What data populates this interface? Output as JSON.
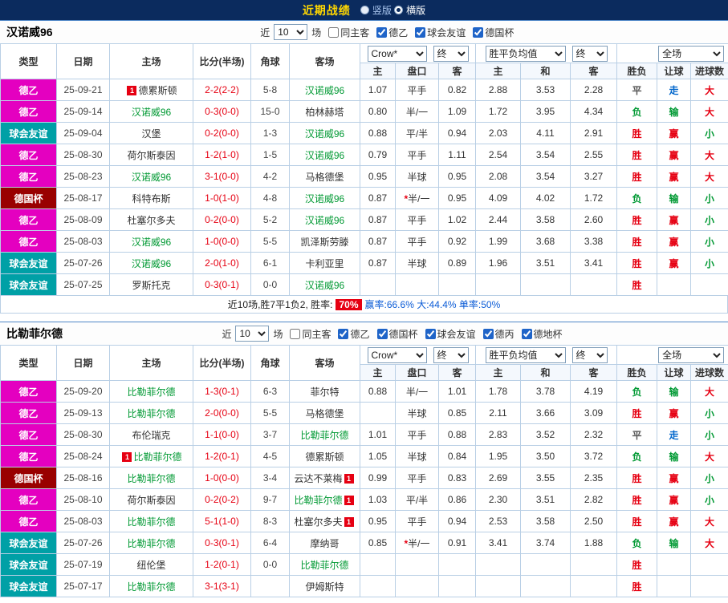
{
  "top_bar": {
    "title": "近期战绩",
    "layout_options": [
      {
        "label": "竖版",
        "selected": false
      },
      {
        "label": "横版",
        "selected": true
      }
    ]
  },
  "colors": {
    "topbar_bg": "#0b2b5e",
    "title": "#ffd700",
    "red": "#e60012",
    "green": "#009933",
    "blue": "#0066cc",
    "dark": "#555",
    "focal_team": "#009933",
    "types": {
      "德乙": "#e400c0",
      "球会友谊": "#00a0a6",
      "德国杯": "#990000"
    }
  },
  "table_header": {
    "type": "类型",
    "date": "日期",
    "home": "主场",
    "score": "比分(半场)",
    "corners": "角球",
    "away": "客场",
    "odds_source": "Crow*",
    "final": "终",
    "avg_label": "胜平负均值",
    "scope": "全场",
    "ah_home": "主",
    "ah_line": "盘口",
    "ah_away": "客",
    "eu_home": "主",
    "eu_draw": "和",
    "eu_away": "客",
    "result": "胜负",
    "handicap": "让球",
    "goals": "进球数"
  },
  "sections": [
    {
      "team": "汉诺威96",
      "controls": {
        "near": "近",
        "count": "10",
        "unit": "场",
        "same_venue": {
          "label": "同主客",
          "checked": false
        },
        "filters": [
          {
            "label": "德乙",
            "checked": true
          },
          {
            "label": "球会友谊",
            "checked": true
          },
          {
            "label": "德国杯",
            "checked": true
          }
        ]
      },
      "rows": [
        {
          "type": "德乙",
          "date": "25-09-21",
          "home": {
            "name": "德累斯顿",
            "badge": "1"
          },
          "score": "2-2(2-2)",
          "corners": "5-8",
          "away": {
            "name": "汉诺威96",
            "focal": true
          },
          "ah": [
            "1.07",
            "平手",
            "0.82"
          ],
          "eu": [
            "2.88",
            "3.53",
            "2.28"
          ],
          "results": [
            {
              "text": "平",
              "color": "dark"
            },
            {
              "text": "走",
              "color": "blue"
            },
            {
              "text": "大",
              "color": "red"
            }
          ]
        },
        {
          "type": "德乙",
          "date": "25-09-14",
          "home": {
            "name": "汉诺威96",
            "focal": true
          },
          "score": "0-3(0-0)",
          "corners": "15-0",
          "away": {
            "name": "柏林赫塔"
          },
          "ah": [
            "0.80",
            "半/一",
            "1.09"
          ],
          "eu": [
            "1.72",
            "3.95",
            "4.34"
          ],
          "results": [
            {
              "text": "负",
              "color": "green"
            },
            {
              "text": "输",
              "color": "green"
            },
            {
              "text": "大",
              "color": "red"
            }
          ]
        },
        {
          "type": "球会友谊",
          "date": "25-09-04",
          "home": {
            "name": "汉堡"
          },
          "score": "0-2(0-0)",
          "corners": "1-3",
          "away": {
            "name": "汉诺威96",
            "focal": true
          },
          "ah": [
            "0.88",
            "平/半",
            "0.94"
          ],
          "eu": [
            "2.03",
            "4.11",
            "2.91"
          ],
          "results": [
            {
              "text": "胜",
              "color": "red"
            },
            {
              "text": "赢",
              "color": "red"
            },
            {
              "text": "小",
              "color": "green"
            }
          ]
        },
        {
          "type": "德乙",
          "date": "25-08-30",
          "home": {
            "name": "荷尔斯泰因"
          },
          "score": "1-2(1-0)",
          "corners": "1-5",
          "away": {
            "name": "汉诺威96",
            "focal": true
          },
          "ah": [
            "0.79",
            "平手",
            "1.11"
          ],
          "eu": [
            "2.54",
            "3.54",
            "2.55"
          ],
          "results": [
            {
              "text": "胜",
              "color": "red"
            },
            {
              "text": "赢",
              "color": "red"
            },
            {
              "text": "大",
              "color": "red"
            }
          ]
        },
        {
          "type": "德乙",
          "date": "25-08-23",
          "home": {
            "name": "汉诺威96",
            "focal": true
          },
          "score": "3-1(0-0)",
          "corners": "4-2",
          "away": {
            "name": "马格德堡"
          },
          "ah": [
            "0.95",
            "半球",
            "0.95"
          ],
          "eu": [
            "2.08",
            "3.54",
            "3.27"
          ],
          "results": [
            {
              "text": "胜",
              "color": "red"
            },
            {
              "text": "赢",
              "color": "red"
            },
            {
              "text": "大",
              "color": "red"
            }
          ]
        },
        {
          "type": "德国杯",
          "date": "25-08-17",
          "home": {
            "name": "科特布斯"
          },
          "score": "1-0(1-0)",
          "corners": "4-8",
          "away": {
            "name": "汉诺威96",
            "focal": true
          },
          "ah": [
            "0.87",
            "*半/一",
            "0.95"
          ],
          "eu": [
            "4.09",
            "4.02",
            "1.72"
          ],
          "results": [
            {
              "text": "负",
              "color": "green"
            },
            {
              "text": "输",
              "color": "green"
            },
            {
              "text": "小",
              "color": "green"
            }
          ]
        },
        {
          "type": "德乙",
          "date": "25-08-09",
          "home": {
            "name": "杜塞尔多夫"
          },
          "score": "0-2(0-0)",
          "corners": "5-2",
          "away": {
            "name": "汉诺威96",
            "focal": true
          },
          "ah": [
            "0.87",
            "平手",
            "1.02"
          ],
          "eu": [
            "2.44",
            "3.58",
            "2.60"
          ],
          "results": [
            {
              "text": "胜",
              "color": "red"
            },
            {
              "text": "赢",
              "color": "red"
            },
            {
              "text": "小",
              "color": "green"
            }
          ]
        },
        {
          "type": "德乙",
          "date": "25-08-03",
          "home": {
            "name": "汉诺威96",
            "focal": true
          },
          "score": "1-0(0-0)",
          "corners": "5-5",
          "away": {
            "name": "凯泽斯劳滕"
          },
          "ah": [
            "0.87",
            "平手",
            "0.92"
          ],
          "eu": [
            "1.99",
            "3.68",
            "3.38"
          ],
          "results": [
            {
              "text": "胜",
              "color": "red"
            },
            {
              "text": "赢",
              "color": "red"
            },
            {
              "text": "小",
              "color": "green"
            }
          ]
        },
        {
          "type": "球会友谊",
          "date": "25-07-26",
          "home": {
            "name": "汉诺威96",
            "focal": true
          },
          "score": "2-0(1-0)",
          "corners": "6-1",
          "away": {
            "name": "卡利亚里"
          },
          "ah": [
            "0.87",
            "半球",
            "0.89"
          ],
          "eu": [
            "1.96",
            "3.51",
            "3.41"
          ],
          "results": [
            {
              "text": "胜",
              "color": "red"
            },
            {
              "text": "赢",
              "color": "red"
            },
            {
              "text": "小",
              "color": "green"
            }
          ]
        },
        {
          "type": "球会友谊",
          "date": "25-07-25",
          "home": {
            "name": "罗斯托克"
          },
          "score": "0-3(0-1)",
          "corners": "0-0",
          "away": {
            "name": "汉诺威96",
            "focal": true
          },
          "ah": [
            "",
            "",
            ""
          ],
          "eu": [
            "",
            "",
            ""
          ],
          "results": [
            {
              "text": "胜",
              "color": "red"
            },
            {
              "text": "",
              "color": "dark"
            },
            {
              "text": "",
              "color": "dark"
            }
          ]
        }
      ],
      "summary": {
        "prefix": "近10场,胜7平1负2, 胜率: ",
        "rate": "70%",
        "stats": "赢率:66.6% 大:44.4% 单率:50%"
      }
    },
    {
      "team": "比勒菲尔德",
      "controls": {
        "near": "近",
        "count": "10",
        "unit": "场",
        "same_venue": {
          "label": "同主客",
          "checked": false
        },
        "filters": [
          {
            "label": "德乙",
            "checked": true
          },
          {
            "label": "德国杯",
            "checked": true
          },
          {
            "label": "球会友谊",
            "checked": true
          },
          {
            "label": "德丙",
            "checked": true
          },
          {
            "label": "德地杯",
            "checked": true
          }
        ]
      },
      "rows": [
        {
          "type": "德乙",
          "date": "25-09-20",
          "home": {
            "name": "比勒菲尔德",
            "focal": true
          },
          "score": "1-3(0-1)",
          "corners": "6-3",
          "away": {
            "name": "菲尔特"
          },
          "ah": [
            "0.88",
            "半/一",
            "1.01"
          ],
          "eu": [
            "1.78",
            "3.78",
            "4.19"
          ],
          "results": [
            {
              "text": "负",
              "color": "green"
            },
            {
              "text": "输",
              "color": "green"
            },
            {
              "text": "大",
              "color": "red"
            }
          ]
        },
        {
          "type": "德乙",
          "date": "25-09-13",
          "home": {
            "name": "比勒菲尔德",
            "focal": true
          },
          "score": "2-0(0-0)",
          "corners": "5-5",
          "away": {
            "name": "马格德堡"
          },
          "ah": [
            "",
            "半球",
            "0.85"
          ],
          "eu": [
            "2.11",
            "3.66",
            "3.09"
          ],
          "results": [
            {
              "text": "胜",
              "color": "red"
            },
            {
              "text": "赢",
              "color": "red"
            },
            {
              "text": "小",
              "color": "green"
            }
          ]
        },
        {
          "type": "德乙",
          "date": "25-08-30",
          "home": {
            "name": "布伦瑞克"
          },
          "score": "1-1(0-0)",
          "corners": "3-7",
          "away": {
            "name": "比勒菲尔德",
            "focal": true
          },
          "ah": [
            "1.01",
            "平手",
            "0.88"
          ],
          "eu": [
            "2.83",
            "3.52",
            "2.32"
          ],
          "results": [
            {
              "text": "平",
              "color": "dark"
            },
            {
              "text": "走",
              "color": "blue"
            },
            {
              "text": "小",
              "color": "green"
            }
          ]
        },
        {
          "type": "德乙",
          "date": "25-08-24",
          "home": {
            "name": "比勒菲尔德",
            "focal": true,
            "badge": "1"
          },
          "score": "1-2(0-1)",
          "corners": "4-5",
          "away": {
            "name": "德累斯顿"
          },
          "ah": [
            "1.05",
            "半球",
            "0.84"
          ],
          "eu": [
            "1.95",
            "3.50",
            "3.72"
          ],
          "results": [
            {
              "text": "负",
              "color": "green"
            },
            {
              "text": "输",
              "color": "green"
            },
            {
              "text": "大",
              "color": "red"
            }
          ]
        },
        {
          "type": "德国杯",
          "date": "25-08-16",
          "home": {
            "name": "比勒菲尔德",
            "focal": true
          },
          "score": "1-0(0-0)",
          "corners": "3-4",
          "away": {
            "name": "云达不莱梅",
            "badge": "1"
          },
          "ah": [
            "0.99",
            "平手",
            "0.83"
          ],
          "eu": [
            "2.69",
            "3.55",
            "2.35"
          ],
          "results": [
            {
              "text": "胜",
              "color": "red"
            },
            {
              "text": "赢",
              "color": "red"
            },
            {
              "text": "小",
              "color": "green"
            }
          ]
        },
        {
          "type": "德乙",
          "date": "25-08-10",
          "home": {
            "name": "荷尔斯泰因"
          },
          "score": "0-2(0-2)",
          "corners": "9-7",
          "away": {
            "name": "比勒菲尔德",
            "focal": true,
            "badge": "1"
          },
          "ah": [
            "1.03",
            "平/半",
            "0.86"
          ],
          "eu": [
            "2.30",
            "3.51",
            "2.82"
          ],
          "results": [
            {
              "text": "胜",
              "color": "red"
            },
            {
              "text": "赢",
              "color": "red"
            },
            {
              "text": "小",
              "color": "green"
            }
          ]
        },
        {
          "type": "德乙",
          "date": "25-08-03",
          "home": {
            "name": "比勒菲尔德",
            "focal": true
          },
          "score": "5-1(1-0)",
          "corners": "8-3",
          "away": {
            "name": "杜塞尔多夫",
            "badge": "1"
          },
          "ah": [
            "0.95",
            "平手",
            "0.94"
          ],
          "eu": [
            "2.53",
            "3.58",
            "2.50"
          ],
          "results": [
            {
              "text": "胜",
              "color": "red"
            },
            {
              "text": "赢",
              "color": "red"
            },
            {
              "text": "大",
              "color": "red"
            }
          ]
        },
        {
          "type": "球会友谊",
          "date": "25-07-26",
          "home": {
            "name": "比勒菲尔德",
            "focal": true
          },
          "score": "0-3(0-1)",
          "corners": "6-4",
          "away": {
            "name": "摩纳哥"
          },
          "ah": [
            "0.85",
            "*半/一",
            "0.91"
          ],
          "eu": [
            "3.41",
            "3.74",
            "1.88"
          ],
          "results": [
            {
              "text": "负",
              "color": "green"
            },
            {
              "text": "输",
              "color": "green"
            },
            {
              "text": "大",
              "color": "red"
            }
          ]
        },
        {
          "type": "球会友谊",
          "date": "25-07-19",
          "home": {
            "name": "纽伦堡"
          },
          "score": "1-2(0-1)",
          "corners": "0-0",
          "away": {
            "name": "比勒菲尔德",
            "focal": true
          },
          "ah": [
            "",
            "",
            ""
          ],
          "eu": [
            "",
            "",
            ""
          ],
          "results": [
            {
              "text": "胜",
              "color": "red"
            },
            {
              "text": "",
              "color": "dark"
            },
            {
              "text": "",
              "color": "dark"
            }
          ]
        },
        {
          "type": "球会友谊",
          "date": "25-07-17",
          "home": {
            "name": "比勒菲尔德",
            "focal": true
          },
          "score": "3-1(3-1)",
          "corners": "",
          "away": {
            "name": "伊姆斯特"
          },
          "ah": [
            "",
            "",
            ""
          ],
          "eu": [
            "",
            "",
            ""
          ],
          "results": [
            {
              "text": "胜",
              "color": "red"
            },
            {
              "text": "",
              "color": "dark"
            },
            {
              "text": "",
              "color": "dark"
            }
          ]
        }
      ],
      "summary": null
    }
  ]
}
